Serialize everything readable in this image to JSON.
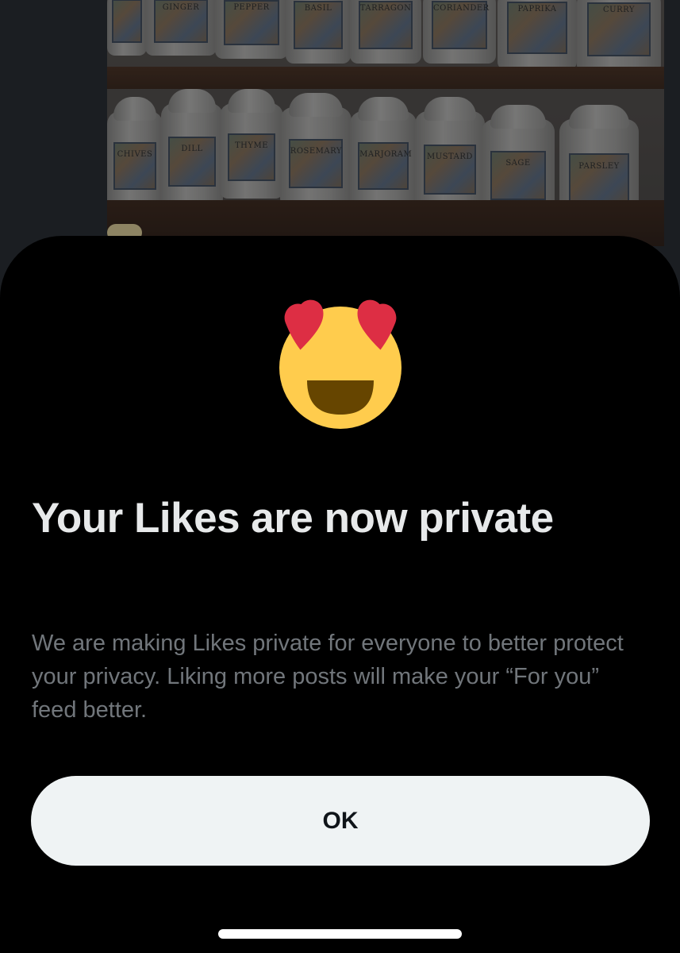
{
  "background_photo": {
    "jar_labels_top": [
      "GINGER",
      "PEPPER",
      "BASIL",
      "TARRAGON",
      "CORIANDER",
      "PAPRIKA",
      "CURRY"
    ],
    "jar_labels_bottom": [
      "CHIVES",
      "DILL",
      "THYME",
      "ROSEMARY",
      "MARJORAM",
      "MUSTARD",
      "SAGE",
      "PARSLEY"
    ]
  },
  "sheet": {
    "icon": "smiling-face-with-heart-eyes-icon",
    "title": "Your Likes are now private",
    "description": "We are making Likes private for everyone to better protect your privacy. Liking more posts will make your “For you” feed better.",
    "ok_label": "OK"
  },
  "colors": {
    "sheet_background": "#000000",
    "title": "#e7e9ea",
    "description": "#71767b",
    "button_background": "#eff3f4",
    "button_text": "#0f1419",
    "emoji_face": "#FFCC4D",
    "emoji_hearts": "#DD2E44",
    "emoji_mouth": "#664500"
  }
}
